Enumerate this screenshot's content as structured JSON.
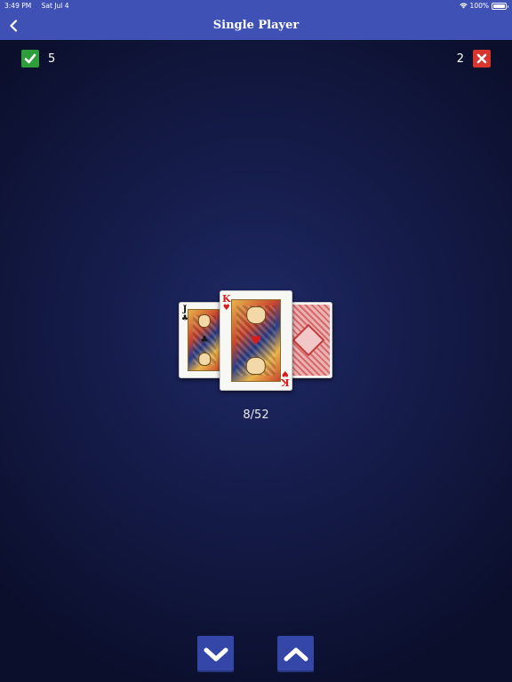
{
  "status_bar": {
    "time": "3:49 PM",
    "date": "Sat Jul 4",
    "battery": "100%"
  },
  "nav": {
    "title": "Single Player",
    "back_icon": "chevron-left-icon"
  },
  "score": {
    "correct": "5",
    "wrong": "2",
    "correct_color": "#2e9e3a",
    "wrong_color": "#d8352e"
  },
  "cards": {
    "previous": {
      "rank": "J",
      "suit": "♣",
      "suit_name": "clubs"
    },
    "current": {
      "rank": "K",
      "suit": "♥",
      "suit_name": "hearts"
    },
    "next": {
      "face_down": true
    }
  },
  "counter": "8/52",
  "controls": {
    "lower_icon": "chevron-down-icon",
    "higher_icon": "chevron-up-icon",
    "button_color": "#3446a8"
  },
  "colors": {
    "bar": "#3f51b5",
    "background": "#151c4a"
  }
}
